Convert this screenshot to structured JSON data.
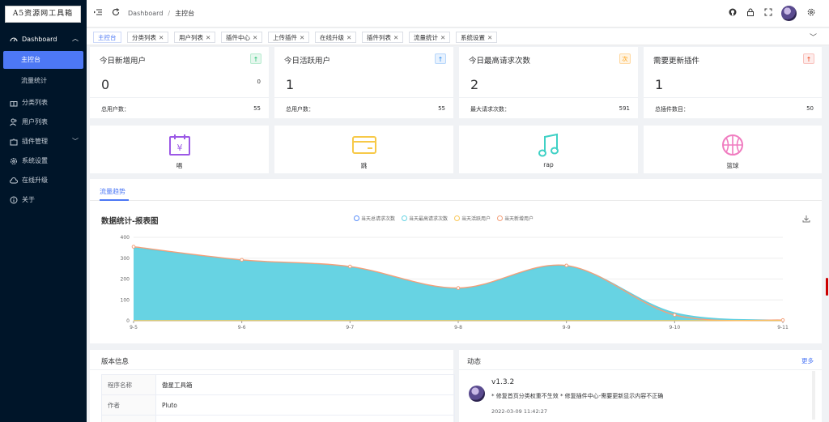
{
  "brand": {
    "logo_text": "A5资源网工具箱"
  },
  "colors": {
    "accent": "#4d78f5",
    "sidebar_bg": "#001529",
    "area_fill": "#67d3e3",
    "line_orange": "#f4a07a"
  },
  "sidebar": {
    "dashboard": {
      "label": "Dashboard",
      "icon": "dashboard-icon"
    },
    "sub_items": [
      {
        "label": "主控台",
        "active": true
      },
      {
        "label": "流量统计",
        "active": false
      }
    ],
    "items": [
      {
        "label": "分类列表",
        "icon": "gift-icon"
      },
      {
        "label": "用户列表",
        "icon": "users-icon"
      },
      {
        "label": "插件管理",
        "icon": "puzzle-icon",
        "has_arrow": true
      },
      {
        "label": "系统设置",
        "icon": "gear-icon"
      },
      {
        "label": "在线升级",
        "icon": "cloud-icon"
      },
      {
        "label": "关于",
        "icon": "info-icon"
      }
    ]
  },
  "header": {
    "breadcrumb": [
      "Dashboard",
      "主控台"
    ],
    "icons": [
      "menu-fold-icon",
      "refresh-icon",
      "github-icon",
      "lock-icon",
      "fullscreen-icon",
      "avatar",
      "settings-icon"
    ]
  },
  "tabs": [
    {
      "label": "主控台",
      "closable": false
    },
    {
      "label": "分类列表",
      "closable": true
    },
    {
      "label": "用户列表",
      "closable": true
    },
    {
      "label": "插件中心",
      "closable": true
    },
    {
      "label": "上传插件",
      "closable": true
    },
    {
      "label": "在线升级",
      "closable": true
    },
    {
      "label": "插件列表",
      "closable": true
    },
    {
      "label": "流量统计",
      "closable": true
    },
    {
      "label": "系统设置",
      "closable": true
    }
  ],
  "stats": [
    {
      "title": "今日新增用户",
      "badge": "↑",
      "badge_color": "#19be6b",
      "value": "0",
      "small": "0",
      "foot_label": "总用户数：",
      "foot_value": "55"
    },
    {
      "title": "今日活跃用户",
      "badge": "↑",
      "badge_color": "#2d8cf0",
      "value": "1",
      "small": "",
      "foot_label": "总用户数：",
      "foot_value": "55"
    },
    {
      "title": "今日最高请求次数",
      "badge": "次",
      "badge_color": "#ff9900",
      "value": "2",
      "small": "",
      "foot_label": "最大请求次数：",
      "foot_value": "591"
    },
    {
      "title": "需要更新插件",
      "badge": "↑",
      "badge_color": "#ed4014",
      "value": "1",
      "small": "",
      "foot_label": "总插件数目：",
      "foot_value": "50"
    }
  ],
  "icon_cards": [
    {
      "label": "唱",
      "icon": "calendar-yen-icon",
      "color": "#9c59e6"
    },
    {
      "label": "跳",
      "icon": "credit-card-icon",
      "color": "#f7c948"
    },
    {
      "label": "rap",
      "icon": "music-note-icon",
      "color": "#3fd1c5"
    },
    {
      "label": "篮球",
      "icon": "basketball-icon",
      "color": "#f07cc0"
    }
  ],
  "chart_panel": {
    "tab_label": "流量趋势",
    "download_icon": "download-icon"
  },
  "chart_data": {
    "type": "area",
    "title": "数据统计-报表图",
    "x": [
      "9-5",
      "9-6",
      "9-7",
      "9-8",
      "9-9",
      "9-10",
      "9-11"
    ],
    "ylim": [
      0,
      400
    ],
    "yticks": [
      0,
      100,
      200,
      300,
      400
    ],
    "grid": true,
    "legend_position": "top-center",
    "series": [
      {
        "name": "当天总请求次数",
        "color": "#5b8ff9",
        "values": [
          350,
          290,
          258,
          155,
          262,
          38,
          2
        ]
      },
      {
        "name": "当天最高请求次数",
        "color": "#67d3e3",
        "values": [
          350,
          290,
          258,
          155,
          262,
          38,
          2
        ]
      },
      {
        "name": "当天活跃用户",
        "color": "#fac858",
        "values": [
          1,
          1,
          1,
          1,
          1,
          1,
          1
        ]
      },
      {
        "name": "当天新增用户",
        "color": "#f4a07a",
        "values": [
          355,
          292,
          260,
          157,
          265,
          28,
          3
        ]
      }
    ]
  },
  "version_panel": {
    "title": "版本信息",
    "rows": [
      {
        "key": "程序名称",
        "value": "傲星工具箱"
      },
      {
        "key": "作者",
        "value": "Pluto"
      },
      {
        "key": "",
        "value": ""
      }
    ]
  },
  "activity_panel": {
    "title": "动态",
    "more": "更多",
    "entries": [
      {
        "version": "v1.3.2",
        "desc": "* 修复首页分类权重不生效 * 修复插件中心-需要更新显示内容不正确",
        "time": "2022-03-09 11:42:27"
      }
    ]
  }
}
